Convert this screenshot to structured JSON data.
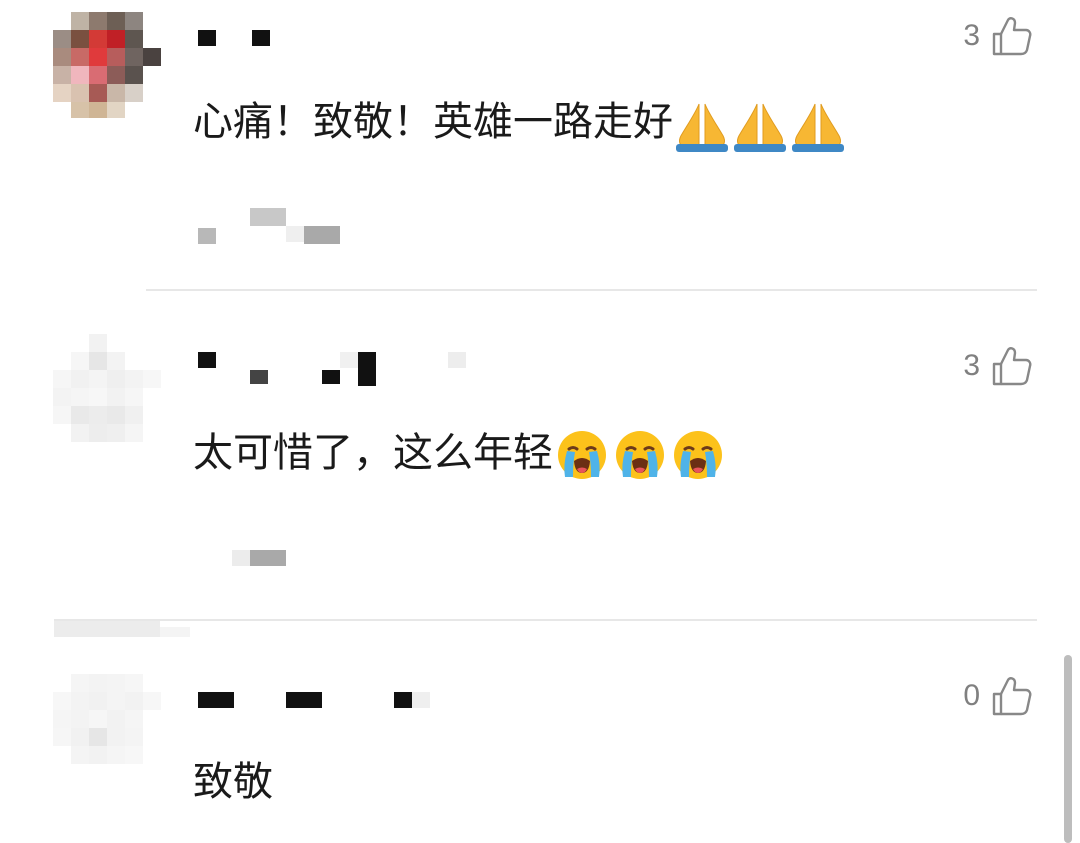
{
  "comments": [
    {
      "text": "心痛！致敬！英雄一路走好",
      "emoji": "pray-emoji",
      "emoji_count": 3,
      "likes": "3"
    },
    {
      "text": "太可惜了，这么年轻",
      "emoji": "loudly-crying-face-emoji",
      "emoji_count": 3,
      "likes": "3"
    },
    {
      "text": "致敬",
      "emoji": "",
      "emoji_count": 0,
      "likes": "0"
    }
  ],
  "icons": {
    "like": "thumbs-up-icon"
  },
  "colors": {
    "text": "#1a1a1a",
    "meta": "#808080",
    "divider": "#e7e7e7"
  }
}
